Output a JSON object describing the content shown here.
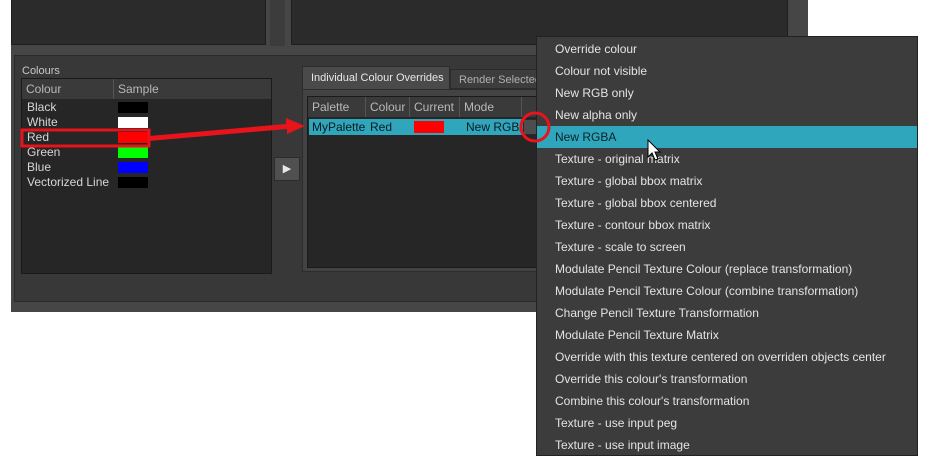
{
  "colours_panel": {
    "title": "Colours",
    "headers": {
      "colour": "Colour",
      "sample": "Sample"
    },
    "items": [
      {
        "name": "Black",
        "color": "#000000"
      },
      {
        "name": "White",
        "color": "#ffffff"
      },
      {
        "name": "Red",
        "color": "#ff0000"
      },
      {
        "name": "Green",
        "color": "#00ff00"
      },
      {
        "name": "Blue",
        "color": "#0000ff"
      },
      {
        "name": "Vectorized Line",
        "color": "#000000"
      }
    ]
  },
  "add_button": {
    "icon": "play-triangle-icon",
    "glyph": "▶"
  },
  "tabs": {
    "overrides": "Individual Colour Overrides",
    "render": "Render Selected"
  },
  "overrides_table": {
    "headers": {
      "palette": "Palette",
      "colour": "Colour",
      "current": "Current",
      "mode": "Mode"
    },
    "row": {
      "palette": "MyPalette",
      "colour": "Red",
      "current_color": "#ff0000",
      "mode": "New RGBA"
    }
  },
  "context_menu": {
    "selected_index": 4,
    "items": [
      "Override colour",
      "Colour not visible",
      "New RGB only",
      "New alpha only",
      "New RGBA",
      "Texture - original matrix",
      "Texture - global bbox matrix",
      "Texture - global bbox centered",
      "Texture - contour bbox matrix",
      "Texture - scale to screen",
      "Modulate Pencil Texture Colour (replace transformation)",
      "Modulate Pencil Texture Colour (combine transformation)",
      "Change Pencil Texture Transformation",
      "Modulate Pencil Texture Matrix",
      "Override with this texture centered on overriden objects center",
      "Override this colour's transformation",
      "Combine this colour's transformation",
      "Texture - use input peg",
      "Texture - use input image"
    ]
  },
  "annotation_color": "#e8131b",
  "selection_color": "#2fa6bb"
}
